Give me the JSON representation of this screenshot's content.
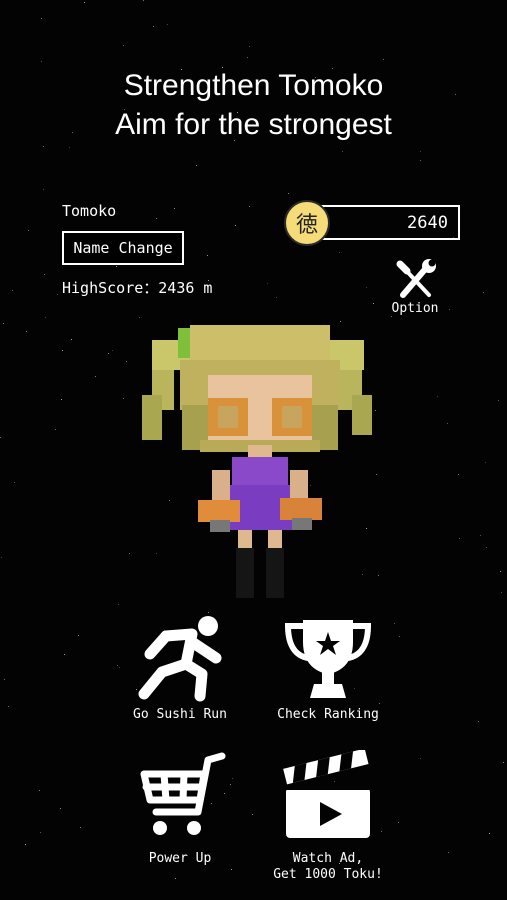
{
  "header": {
    "title_line1": "Strengthen Tomoko",
    "title_line2": "Aim for the strongest"
  },
  "player": {
    "name": "Tomoko",
    "name_change_label": "Name Change",
    "highscore_text": "HighScore：2436 m"
  },
  "currency": {
    "icon_glyph": "徳",
    "value": "2640",
    "coin_color": "#f5dc79"
  },
  "option": {
    "label": "Option",
    "icon": "wrench-screwdriver-icon"
  },
  "menu": {
    "run_label": "Go Sushi Run",
    "ranking_label": "Check Ranking",
    "powerup_label": "Power Up",
    "watchad_label_line1": "Watch Ad,",
    "watchad_label_line2": "Get 1000 Toku!"
  }
}
